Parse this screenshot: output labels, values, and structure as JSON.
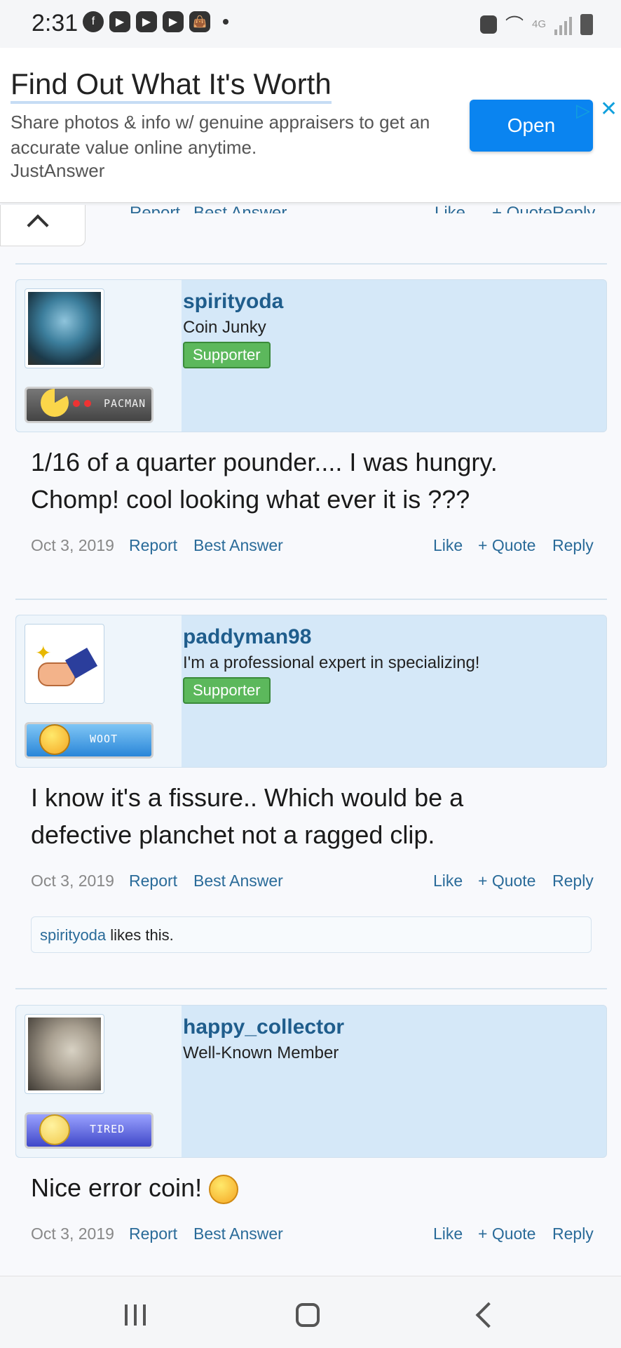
{
  "status_bar": {
    "time": "2:31",
    "network": "4G"
  },
  "ad": {
    "title": "Find Out What It's Worth",
    "body": "Share photos & info w/ genuine appraisers to get an accurate value online anytime.",
    "sponsor": "JustAnswer",
    "button": "Open"
  },
  "actions": {
    "report": "Report",
    "best_answer": "Best Answer",
    "like": "Like",
    "quote": "+ Quote",
    "reply": "Reply"
  },
  "posts": [
    {
      "username": "spirityoda",
      "user_title": "Coin Junky",
      "supporter": "Supporter",
      "badge": "PACMAN",
      "message_line1": "1/16 of a quarter pounder.... I was hungry.",
      "message_line2": "Chomp! cool looking what ever it is ???",
      "date": "Oct 3, 2019"
    },
    {
      "username": "paddyman98",
      "user_title": "I'm a professional expert in specializing!",
      "supporter": "Supporter",
      "badge": "WOOT",
      "message_line1": "I know it's a fissure.. Which would be a",
      "message_line2": "defective planchet not a ragged clip.",
      "date": "Oct 3, 2019",
      "liked_by": "spirityoda",
      "likes_suffix": " likes this."
    },
    {
      "username": "happy_collector",
      "user_title": "Well-Known Member",
      "badge": "TIRED",
      "message": "Nice error coin! ",
      "date": "Oct 3, 2019"
    }
  ]
}
